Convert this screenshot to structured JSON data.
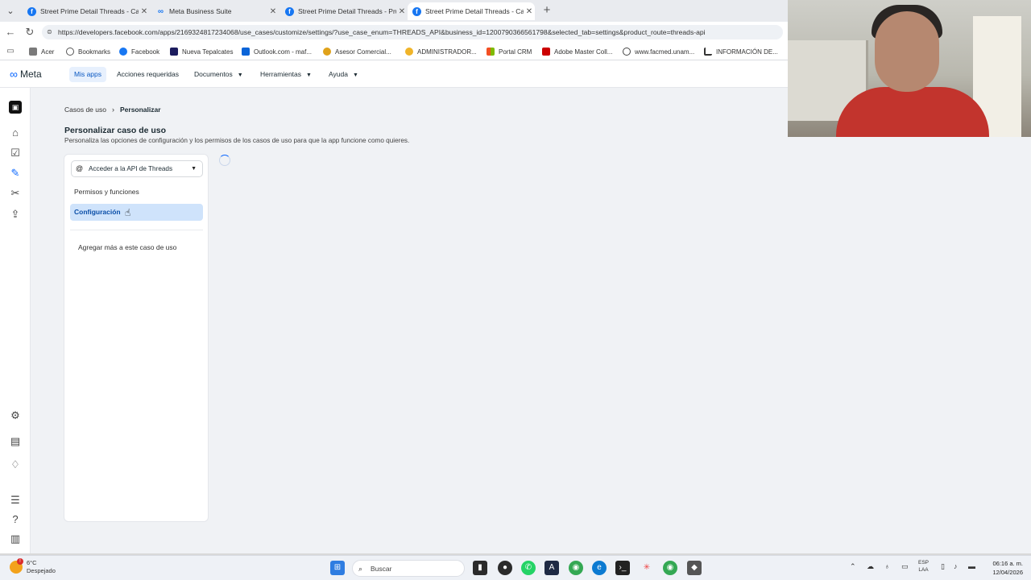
{
  "browser": {
    "tabs": [
      {
        "title": "Street Prime Detail Threads - Caso",
        "icon": "facebook-icon",
        "active": false
      },
      {
        "title": "Meta Business Suite",
        "icon": "meta-icon",
        "active": false
      },
      {
        "title": "Street Prime Detail Threads - Prueb",
        "icon": "facebook-icon",
        "active": false
      },
      {
        "title": "Street Prime Detail Threads - Caso",
        "icon": "facebook-icon",
        "active": true
      }
    ],
    "url": "https://developers.facebook.com/apps/2169324817234068/use_cases/customize/settings/?use_case_enum=THREADS_API&business_id=1200790366561798&selected_tab=settings&product_route=threads-api",
    "bookmarks": [
      {
        "label": "Acer",
        "color": "#7a7a7a"
      },
      {
        "label": "Bookmarks",
        "color": "#555555"
      },
      {
        "label": "Facebook",
        "color": "#1877f2"
      },
      {
        "label": "Nueva Tepalcates",
        "color": "#1c1c5e"
      },
      {
        "label": "Outlook.com - maf...",
        "color": "#0a64d8"
      },
      {
        "label": "Asesor Comercial...",
        "color": "#e0a21a"
      },
      {
        "label": "ADMINISTRADOR...",
        "color": "#f0b429"
      },
      {
        "label": "Portal CRM",
        "color": "#f25022"
      },
      {
        "label": "Adobe Master Coll...",
        "color": "#cc0000"
      },
      {
        "label": "www.facmed.unam...",
        "color": "#444444"
      },
      {
        "label": "INFORMACIÓN DE...",
        "color": "#333333"
      }
    ]
  },
  "topnav": {
    "logo": "Meta",
    "items": [
      {
        "label": "Mis apps",
        "active": true,
        "dropdown": false
      },
      {
        "label": "Acciones requeridas",
        "active": false,
        "dropdown": false
      },
      {
        "label": "Documentos",
        "active": false,
        "dropdown": true
      },
      {
        "label": "Herramientas",
        "active": false,
        "dropdown": true
      },
      {
        "label": "Ayuda",
        "active": false,
        "dropdown": true
      }
    ]
  },
  "breadcrumb": {
    "parent": "Casos de uso",
    "current": "Personalizar"
  },
  "page": {
    "title": "Personalizar caso de uso",
    "subtitle": "Personaliza las opciones de configuración y los permisos de los casos de uso para que la app funcione como quieres."
  },
  "sidepanel": {
    "selector_label": "Acceder a la API de Threads",
    "menu": [
      {
        "label": "Permisos y funciones",
        "selected": false
      },
      {
        "label": "Configuración",
        "selected": true
      }
    ],
    "add_more": "Agregar más a este caso de uso"
  },
  "taskbar": {
    "weather_temp": "6°C",
    "weather_desc": "Despejado",
    "search_placeholder": "Buscar",
    "lang_top": "ESP",
    "lang_bottom": "LAA",
    "time": "06:16 a. m.",
    "date": "12/04/2026"
  },
  "colors": {
    "accent": "#0866ff",
    "selected_bg": "#cfe3fb",
    "page_bg": "#f0f2f5"
  }
}
